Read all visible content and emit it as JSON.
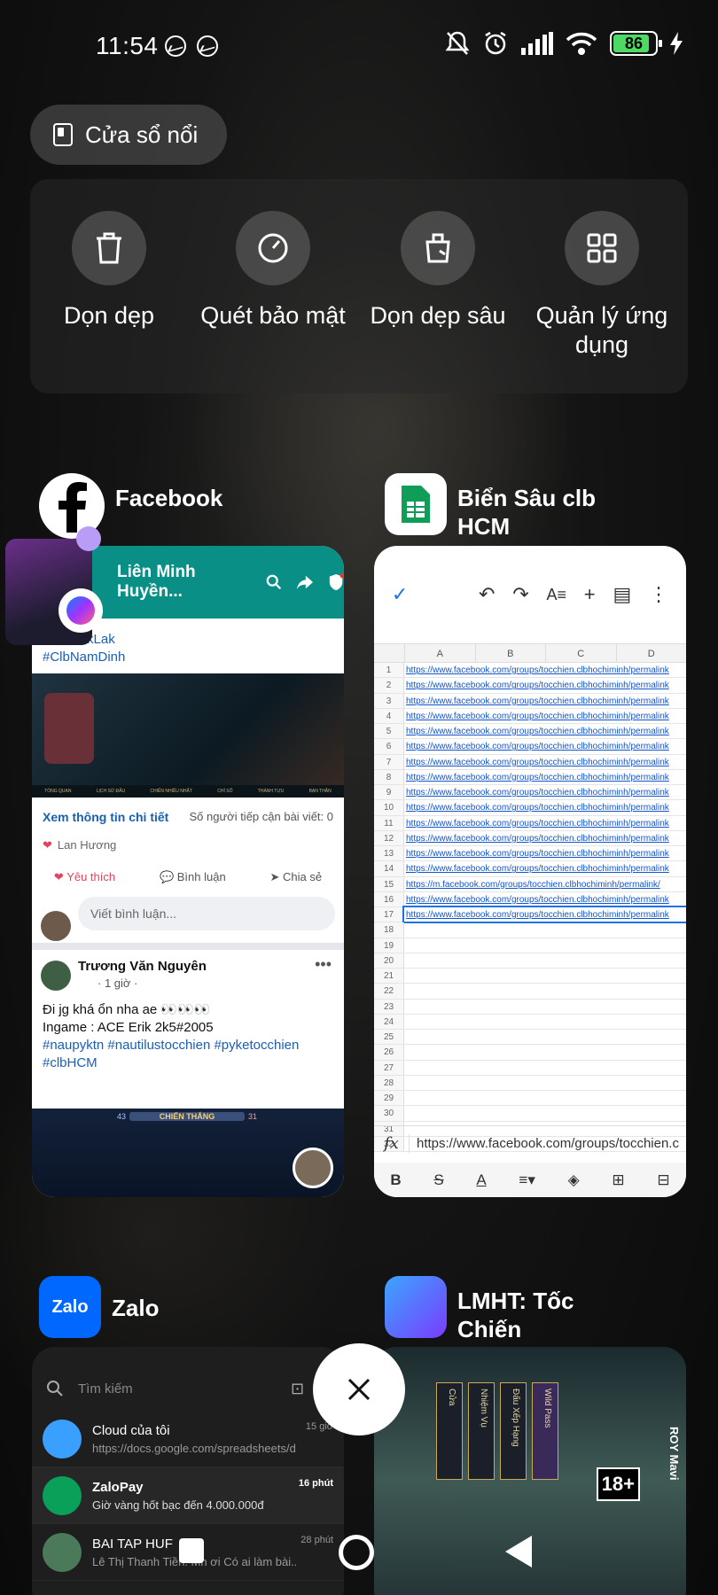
{
  "status_bar": {
    "time": "11:54",
    "battery": "86",
    "battery_level_percent": 86,
    "icons": [
      "messenger-icon",
      "messenger-icon",
      "mute-icon",
      "alarm-icon",
      "signal-icon",
      "wifi-icon",
      "battery-icon",
      "charging-icon"
    ]
  },
  "floating_window": {
    "label": "Cửa sổ nổi"
  },
  "tools": [
    {
      "label": "Dọn dẹp",
      "icon": "trash-icon"
    },
    {
      "label": "Quét bảo mật",
      "icon": "security-scan-icon"
    },
    {
      "label": "Dọn dẹp sâu",
      "icon": "deep-clean-icon"
    },
    {
      "label": "Quản lý ứng dụng",
      "icon": "app-grid-icon"
    }
  ],
  "apps": {
    "facebook": {
      "name": "Facebook",
      "header_title": "Liên Minh Huyền...",
      "hashtags": [
        "#ClbDakLak",
        "#ClbNamDinh"
      ],
      "game_tabs": [
        "TỔNG QUAN",
        "LỊCH SỬ ĐẤU",
        "CHIẾN NHIỀU NHẤT",
        "CHỈ SỐ",
        "THÀNH TỰU",
        "BẠN THÂN"
      ],
      "view_insights": "Xem thông tin chi tiết",
      "reach": "Số người tiếp cận bài viết: 0",
      "reactor": "Lan Hương",
      "actions": [
        "Yêu thích",
        "Bình luận",
        "Chia sẻ"
      ],
      "comment_placeholder": "Viết bình luận...",
      "post_author": "Trương Văn Nguyên",
      "post_time": "· 1 giờ ·",
      "post_line1": "Đi jg khá ổn nha ae 👀👀👀",
      "post_line2": "Ingame : ACE  Erik 2k5#2005",
      "post_tags": "#naupyktn #nautilustocchien #pyketocchien",
      "post_tag2": "#clbHCM",
      "victory": "CHIẾN THẮNG",
      "score_left": "43",
      "score_right": "31"
    },
    "sheets": {
      "name": "Biển Sâu clb HCM",
      "columns": [
        "",
        "A",
        "B",
        "C",
        "D"
      ],
      "rows": [
        "https://www.facebook.com/groups/tocchien.clbhochiminh/permalink",
        "https://www.facebook.com/groups/tocchien.clbhochiminh/permalink",
        "https://www.facebook.com/groups/tocchien.clbhochiminh/permalink",
        "https://www.facebook.com/groups/tocchien.clbhochiminh/permalink",
        "https://www.facebook.com/groups/tocchien.clbhochiminh/permalink",
        "https://www.facebook.com/groups/tocchien.clbhochiminh/permalink",
        "https://www.facebook.com/groups/tocchien.clbhochiminh/permalink",
        "https://www.facebook.com/groups/tocchien.clbhochiminh/permalink",
        "https://www.facebook.com/groups/tocchien.clbhochiminh/permalink",
        "https://www.facebook.com/groups/tocchien.clbhochiminh/permalink",
        "https://www.facebook.com/groups/tocchien.clbhochiminh/permalink",
        "https://www.facebook.com/groups/tocchien.clbhochiminh/permalink",
        "https://www.facebook.com/groups/tocchien.clbhochiminh/permalink",
        "https://www.facebook.com/groups/tocchien.clbhochiminh/permalink",
        "https://m.facebook.com/groups/tocchien.clbhochiminh/permalink/",
        "https://www.facebook.com/groups/tocchien.clbhochiminh/permalink",
        "https://www.facebook.com/groups/tocchien.clbhochiminh/permalink"
      ],
      "row_count": 32,
      "formula": "https://www.facebook.com/groups/tocchien.c"
    },
    "zalo": {
      "name": "Zalo",
      "search_placeholder": "Tìm kiếm",
      "chats": [
        {
          "name": "Cloud của tôi",
          "preview": "https://docs.google.com/spreadsheets/d/...",
          "time": "15 giờ"
        },
        {
          "name": "ZaloPay",
          "preview": "Giờ vàng hốt bạc đến 4.000.000đ",
          "time": "16 phút"
        },
        {
          "name": "BAI TAP HUF",
          "preview": "Lê Thị Thanh Tiền: Mn ơi Có ai làm bài...",
          "time": "28 phút"
        }
      ]
    },
    "game": {
      "name": "LMHT: Tốc Chiến",
      "player": "ROY Mavi",
      "age_rating": "18+",
      "menu": [
        "Cửa",
        "Nhiệm Vụ",
        "Đấu Xếp Hạng",
        "Wild Pass"
      ]
    }
  },
  "colors": {
    "facebook_header": "#0a8f86",
    "zalo_blue": "#0068ff",
    "sheets_green": "#0f9d58",
    "battery_green": "#4cd964"
  }
}
